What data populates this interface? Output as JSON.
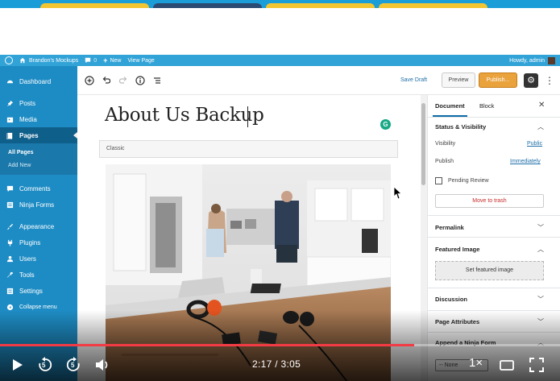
{
  "adminbar": {
    "site_name": "Brandon's Mockups",
    "comments_count": "0",
    "new_label": "New",
    "view_page": "View Page",
    "howdy": "Howdy, admin"
  },
  "sidebar": {
    "items": [
      {
        "label": "Dashboard",
        "icon": "dashboard-icon"
      },
      {
        "label": "Posts",
        "icon": "pin-icon"
      },
      {
        "label": "Media",
        "icon": "media-icon"
      },
      {
        "label": "Pages",
        "icon": "pages-icon"
      },
      {
        "label": "Comments",
        "icon": "comment-icon"
      },
      {
        "label": "Ninja Forms",
        "icon": "form-icon"
      },
      {
        "label": "Appearance",
        "icon": "brush-icon"
      },
      {
        "label": "Plugins",
        "icon": "plug-icon"
      },
      {
        "label": "Users",
        "icon": "user-icon"
      },
      {
        "label": "Tools",
        "icon": "wrench-icon"
      },
      {
        "label": "Settings",
        "icon": "settings-icon"
      },
      {
        "label": "Collapse menu",
        "icon": "collapse-icon"
      }
    ],
    "submenu": [
      {
        "label": "All Pages"
      },
      {
        "label": "Add New"
      }
    ]
  },
  "toolbar": {
    "save_draft": "Save Draft",
    "preview": "Preview",
    "publish": "Publish..."
  },
  "editor": {
    "title": "About Us Backup",
    "classic_label": "Classic"
  },
  "panel": {
    "tab_document": "Document",
    "tab_block": "Block",
    "status_title": "Status & Visibility",
    "visibility_label": "Visibility",
    "visibility_value": "Public",
    "publish_label": "Publish",
    "publish_value": "Immediately",
    "pending_review": "Pending Review",
    "move_to_trash": "Move to trash",
    "permalink": "Permalink",
    "featured_image": "Featured Image",
    "set_featured_image": "Set featured image",
    "discussion": "Discussion",
    "page_attributes": "Page Attributes",
    "append_ninja_form": "Append a Ninja Form",
    "select_none": "-- None"
  },
  "video": {
    "current_time": "2:17",
    "separator": "/",
    "duration": "3:05",
    "progress_fraction": 0.74,
    "speed": "1×",
    "skip_back": "5",
    "skip_forward": "5"
  },
  "colors": {
    "sidebar_bg": "#1e8cc4",
    "adminbar_bg": "#32a3d7",
    "publish_bg": "#e9a23c",
    "progress_fill": "#f23b45",
    "link": "#1e6fa8"
  }
}
